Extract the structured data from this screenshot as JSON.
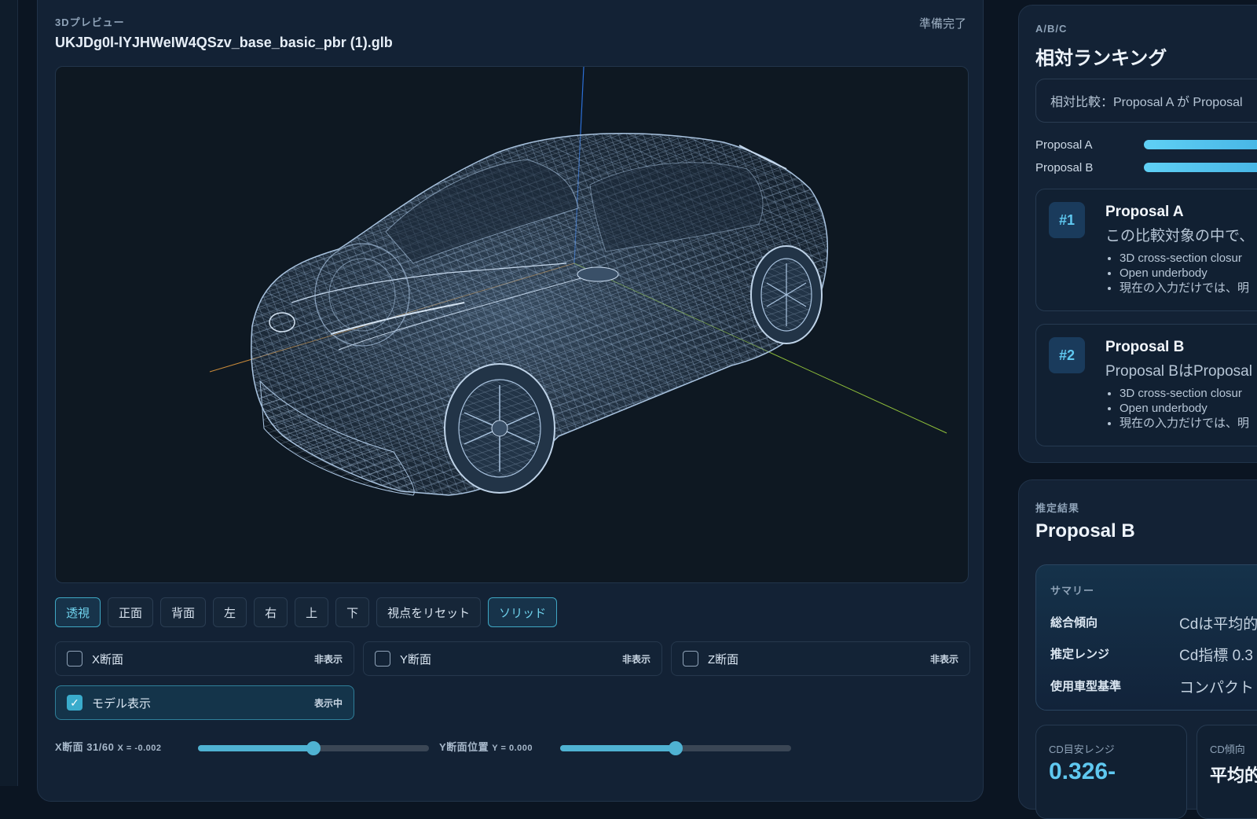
{
  "preview": {
    "section_label": "3Dプレビュー",
    "file_name": "UKJDg0l-lYJHWeIW4QSzv_base_basic_pbr (1).glb",
    "status": "準備完了"
  },
  "toolbar": [
    {
      "label": "透視",
      "active": true
    },
    {
      "label": "正面",
      "active": false
    },
    {
      "label": "背面",
      "active": false
    },
    {
      "label": "左",
      "active": false
    },
    {
      "label": "右",
      "active": false
    },
    {
      "label": "上",
      "active": false
    },
    {
      "label": "下",
      "active": false
    },
    {
      "label": "視点をリセット",
      "active": false
    },
    {
      "label": "ソリッド",
      "active": true
    }
  ],
  "sections": {
    "x": {
      "label": "X断面",
      "state": "非表示",
      "checked": false
    },
    "y": {
      "label": "Y断面",
      "state": "非表示",
      "checked": false
    },
    "z": {
      "label": "Z断面",
      "state": "非表示",
      "checked": false
    },
    "model": {
      "label": "モデル表示",
      "state": "表示中",
      "checked": true
    }
  },
  "sliders": {
    "x": {
      "label": "X断面 31/60",
      "readout": "X = -0.002",
      "value": 0.5
    },
    "y": {
      "label": "Y断面位置",
      "readout": "Y = 0.000",
      "value": 0.5
    }
  },
  "ranking": {
    "section_label": "A/B/C",
    "title": "相対ランキング",
    "comparison": "相対比較：Proposal A が Proposal",
    "bars": [
      {
        "label": "Proposal A"
      },
      {
        "label": "Proposal B"
      }
    ],
    "cards": [
      {
        "rank": "#1",
        "name": "Proposal A",
        "desc": "この比較対象の中で、",
        "bullets": [
          "3D cross-section closur",
          "Open underbody",
          "現在の入力だけでは、明"
        ]
      },
      {
        "rank": "#2",
        "name": "Proposal B",
        "desc": "Proposal BはProposal",
        "bullets": [
          "3D cross-section closur",
          "Open underbody",
          "現在の入力だけでは、明"
        ]
      }
    ]
  },
  "estimate": {
    "section_label": "推定結果",
    "title": "Proposal B",
    "summary": {
      "label": "サマリー",
      "rows": [
        {
          "key": "総合傾向",
          "value": "Cdは平均的"
        },
        {
          "key": "推定レンジ",
          "value": "Cd指標 0.3"
        },
        {
          "key": "使用車型基準",
          "value": "コンパクト"
        }
      ]
    },
    "stats": [
      {
        "label": "CD目安レンジ",
        "value": "0.326-"
      },
      {
        "label": "CD傾向",
        "value": "平均的"
      }
    ]
  },
  "colors": {
    "accent": "#4fb2d2",
    "axis_x": "#c98a3a",
    "axis_y": "#8fbf3a",
    "axis_z": "#2c6fd6",
    "wire": "#8fb0d4"
  }
}
